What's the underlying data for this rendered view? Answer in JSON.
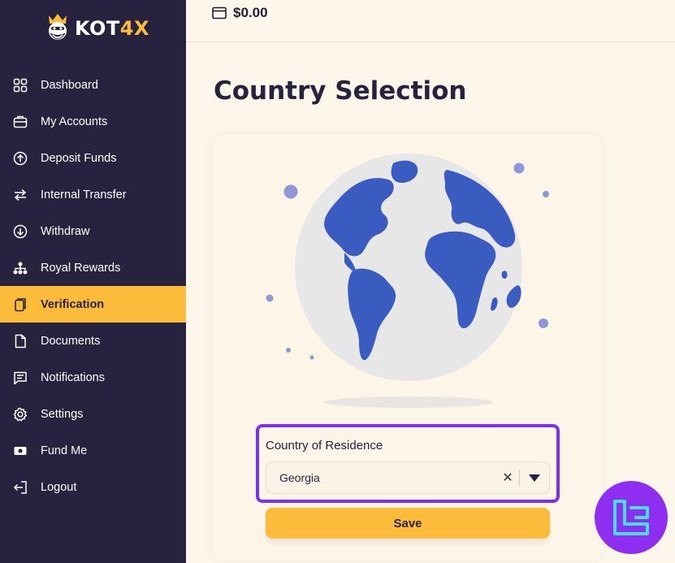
{
  "brand": {
    "name_main": "KOT",
    "name_accent": "4X",
    "accent_color": "#fdbb3a",
    "sidebar_color": "#27233f"
  },
  "header": {
    "balance": "$0.00",
    "balance_icon": "wallet-icon"
  },
  "sidebar": {
    "items": [
      {
        "label": "Dashboard",
        "icon": "grid-icon",
        "active": false
      },
      {
        "label": "My Accounts",
        "icon": "briefcase-icon",
        "active": false
      },
      {
        "label": "Deposit Funds",
        "icon": "arrow-up-circle-icon",
        "active": false
      },
      {
        "label": "Internal Transfer",
        "icon": "transfer-arrows-icon",
        "active": false
      },
      {
        "label": "Withdraw",
        "icon": "arrow-down-circle-icon",
        "active": false
      },
      {
        "label": "Royal Rewards",
        "icon": "network-icon",
        "active": false
      },
      {
        "label": "Verification",
        "icon": "document-copy-icon",
        "active": true
      },
      {
        "label": "Documents",
        "icon": "file-icon",
        "active": false
      },
      {
        "label": "Notifications",
        "icon": "chat-icon",
        "active": false
      },
      {
        "label": "Settings",
        "icon": "gear-icon",
        "active": false
      },
      {
        "label": "Fund Me",
        "icon": "cash-icon",
        "active": false
      },
      {
        "label": "Logout",
        "icon": "logout-icon",
        "active": false
      }
    ]
  },
  "main": {
    "title": "Country Selection",
    "country_field": {
      "label": "Country of Residence",
      "value": "Georgia"
    },
    "save_label": "Save",
    "highlight_color": "#7b2ff7"
  }
}
